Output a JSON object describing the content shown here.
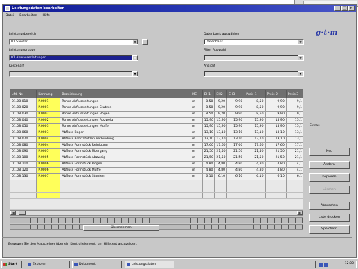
{
  "window": {
    "title": "Leistungsdaten bearbeiten"
  },
  "menu": [
    "Datei",
    "Bearbeiten",
    "Hilfe"
  ],
  "form": {
    "label1": "Leistungsbereich",
    "value1": "01 Sanitär",
    "label2": "Leistungsgruppe",
    "value2": "01 Abwasserleitungen",
    "label3": "Kostenart",
    "value3": "",
    "label4": "Datenbank auswählen",
    "value4": "Datenbank",
    "label5": "Filter Auswahl",
    "value5": "",
    "label6": "Ansicht",
    "value6": ""
  },
  "logo": {
    "text": "g·t·m"
  },
  "grid": {
    "columns": [
      "Lfd. Nr.",
      "Kennung",
      "Bezeichnung",
      "ME",
      "EH1",
      "EH2",
      "EH3",
      "Preis 1",
      "Preis 2",
      "Preis 3"
    ],
    "rows": [
      [
        "01.08.010",
        "P.0001",
        "Rohre Abflussleitungen",
        "m",
        "8,50",
        "9,20",
        "9,90",
        "8,50",
        "9,90",
        "9,1"
      ],
      [
        "01.08.020",
        "P.0001",
        "Rohre Abflussleitungen Stutzen",
        "m",
        "8,50",
        "9,20",
        "9,90",
        "8,50",
        "9,90",
        "9,1"
      ],
      [
        "01.08.030",
        "P.0002",
        "Rohre Abflussleitungen Bogen",
        "m",
        "8,50",
        "9,20",
        "9,90",
        "8,50",
        "9,90",
        "9,1"
      ],
      [
        "01.08.040",
        "P.0002",
        "Rohre Abflussleitungen Abzweig",
        "m",
        "15,90",
        "15,90",
        "15,90",
        "15,90",
        "15,90",
        "15,1"
      ],
      [
        "01.08.050",
        "P.0003",
        "Rohre Abflussleitungen Muffe",
        "m",
        "15,90",
        "15,90",
        "15,90",
        "15,90",
        "15,90",
        "15,1"
      ],
      [
        "01.08.060",
        "P.0003",
        "Abfluss Bogen",
        "m",
        "13,10",
        "13,10",
        "13,10",
        "13,10",
        "13,10",
        "13,1"
      ],
      [
        "01.08.070",
        "P.0004",
        "Abfluss Rohr Stutzen Verbindung",
        "m",
        "13,10",
        "13,10",
        "13,10",
        "13,10",
        "13,10",
        "13,1"
      ],
      [
        "01.08.080",
        "P.0004",
        "Abfluss Formstück Reinigung",
        "m",
        "17,60",
        "17,60",
        "17,60",
        "17,60",
        "17,60",
        "17,1"
      ],
      [
        "01.08.090",
        "P.0005",
        "Abfluss Formstück Übergang",
        "m",
        "21,50",
        "21,50",
        "21,50",
        "21,50",
        "21,50",
        "21,1"
      ],
      [
        "01.08.100",
        "P.0005",
        "Abfluss Formstück Abzweig",
        "m",
        "21,50",
        "21,50",
        "21,50",
        "21,50",
        "21,50",
        "21,1"
      ],
      [
        "01.08.110",
        "P.0006",
        "Abfluss Formstück Bogen",
        "m",
        "4,80",
        "4,80",
        "4,80",
        "4,80",
        "4,80",
        "4,1"
      ],
      [
        "01.08.120",
        "P.0006",
        "Abfluss Formstück Muffe",
        "m",
        "4,80",
        "4,80",
        "4,80",
        "4,80",
        "4,80",
        "4,1"
      ],
      [
        "01.08.130",
        "P.0007",
        "Abfluss Formstück Stopfen",
        "m",
        "6,10",
        "6,10",
        "6,10",
        "6,10",
        "6,10",
        "6,1"
      ]
    ]
  },
  "side": {
    "checkbox_label": "Extras",
    "buttons": [
      "Neu",
      "Ändern",
      "Kopieren",
      "Löschen",
      "Abbrechen",
      "Liste drucken",
      "Speichern"
    ]
  },
  "tick_button": "übernehmen",
  "hint": "Bewegen Sie den Mauszeiger über ein Kontrollelement, um Hilfetext anzuzeigen.",
  "taskbar": {
    "start": "Start",
    "tasks": [
      "Explorer",
      "Dokument",
      "Leistungsdaten"
    ],
    "clock": "12:00"
  }
}
